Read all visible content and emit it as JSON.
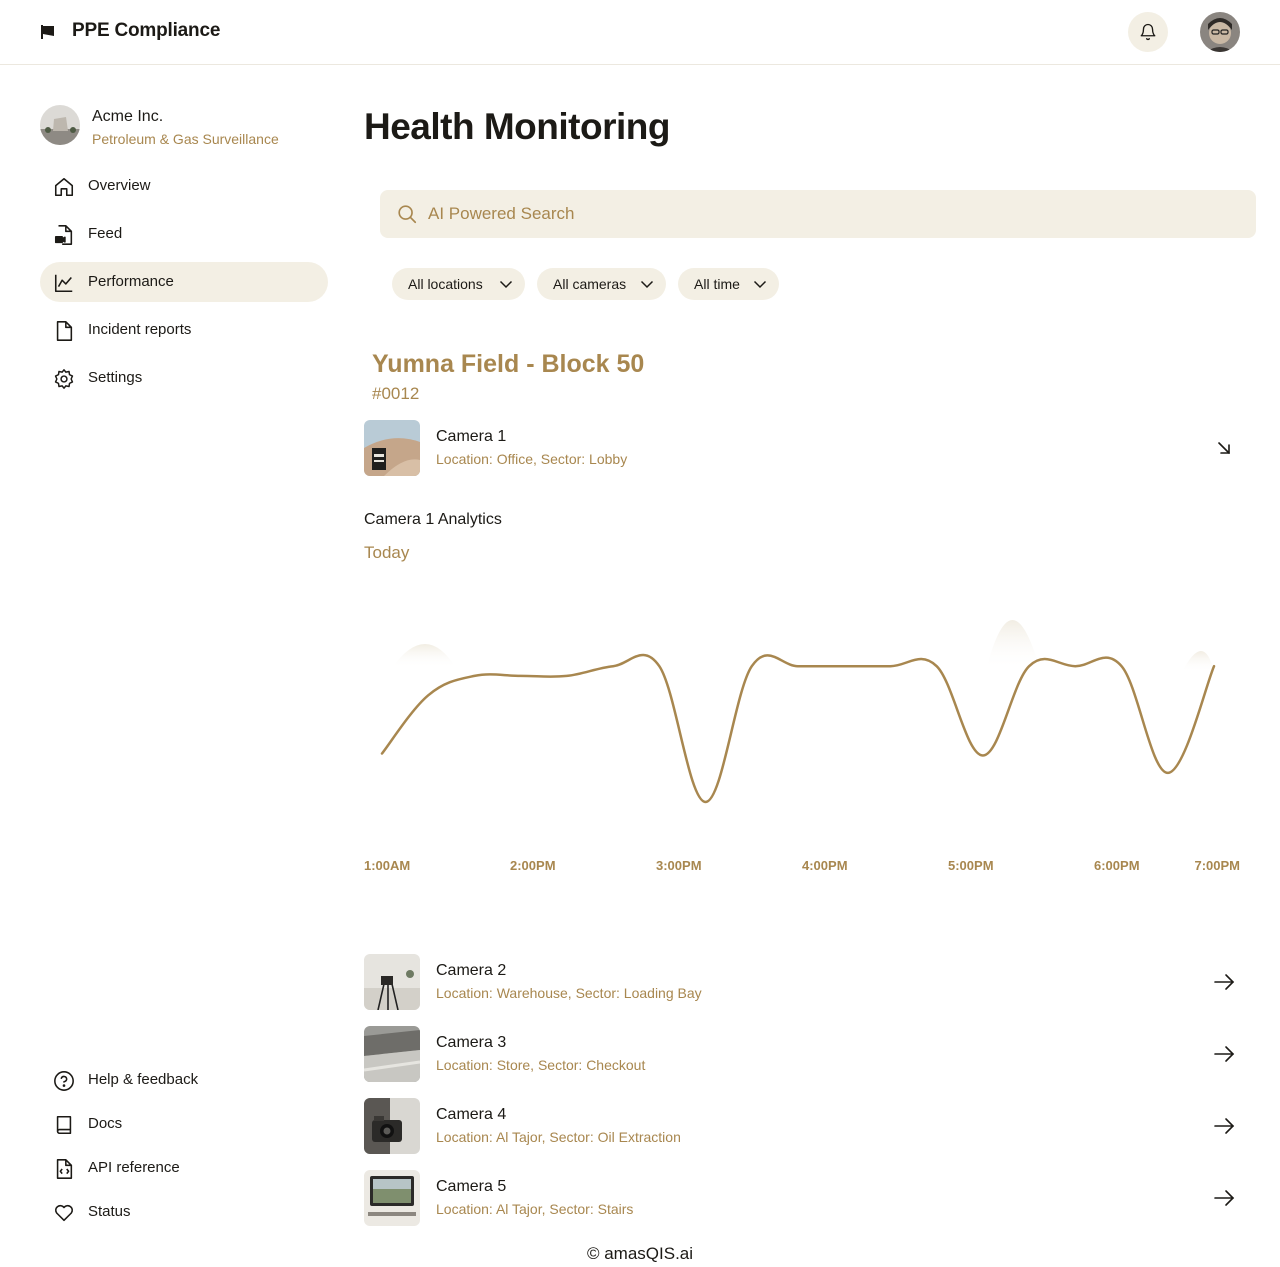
{
  "app": {
    "title": "PPE Compliance"
  },
  "org": {
    "name": "Acme Inc.",
    "subtitle": "Petroleum & Gas Surveillance"
  },
  "nav": {
    "main": [
      {
        "label": "Overview",
        "icon": "home-icon"
      },
      {
        "label": "Feed",
        "icon": "video-file-icon"
      },
      {
        "label": "Performance",
        "icon": "line-chart-icon",
        "active": true
      },
      {
        "label": "Incident reports",
        "icon": "document-icon"
      },
      {
        "label": "Settings",
        "icon": "gear-icon"
      }
    ],
    "footer": [
      {
        "label": "Help & feedback",
        "icon": "help-icon"
      },
      {
        "label": "Docs",
        "icon": "book-icon"
      },
      {
        "label": "API reference",
        "icon": "code-file-icon"
      },
      {
        "label": "Status",
        "icon": "heart-icon"
      }
    ]
  },
  "page": {
    "title": "Health Monitoring"
  },
  "search": {
    "placeholder": "AI Powered Search"
  },
  "filters": [
    {
      "label": "All locations"
    },
    {
      "label": "All cameras"
    },
    {
      "label": "All time"
    }
  ],
  "site": {
    "name": "Yumna Field -  Block 50",
    "id": "#0012"
  },
  "cameras": [
    {
      "name": "Camera 1",
      "location": "Location: Office, Sector: Lobby",
      "expanded": true
    },
    {
      "name": "Camera 2",
      "location": "Location: Warehouse, Sector: Loading Bay"
    },
    {
      "name": "Camera 3",
      "location": "Location: Store, Sector: Checkout"
    },
    {
      "name": "Camera 4",
      "location": "Location: Al Tajor, Sector: Oil Extraction"
    },
    {
      "name": "Camera 5",
      "location": "Location: Al Tajor, Sector: Stairs"
    }
  ],
  "analytics": {
    "title": "Camera 1 Analytics",
    "period": "Today"
  },
  "chart_data": {
    "type": "line",
    "x": [
      "1:00AM",
      "2:00PM",
      "3:00PM",
      "4:00PM",
      "5:00PM",
      "6:00PM",
      "7:00PM"
    ],
    "values": [
      0.25,
      0.55,
      0.65,
      0.65,
      0.65,
      0.7,
      0.7,
      0.0,
      0.7,
      0.7,
      0.7,
      0.7,
      0.7,
      0.24,
      0.7,
      0.7,
      0.7,
      0.15,
      0.7
    ],
    "title": "",
    "xlabel": "",
    "ylabel": "",
    "color": "#a8874f",
    "grid": false
  },
  "footer": {
    "text": "© amasQIS.ai"
  },
  "colors": {
    "accent": "#a8874f",
    "surface": "#f3efe4",
    "text": "#1c1a16"
  }
}
